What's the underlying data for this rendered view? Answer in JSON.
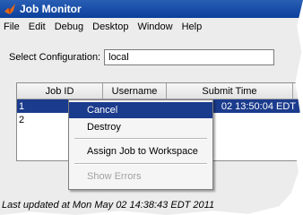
{
  "window": {
    "title": "Job Monitor"
  },
  "menu": [
    "File",
    "Edit",
    "Debug",
    "Desktop",
    "Window",
    "Help"
  ],
  "config": {
    "label": "Select Configuration:",
    "value": "local"
  },
  "table": {
    "headers": [
      "Job ID",
      "Username",
      "Submit Time"
    ],
    "rows": [
      {
        "id": "1",
        "username": "",
        "submit_time": "02 13:50:04 EDT"
      },
      {
        "id": "2",
        "username": "",
        "submit_time": ""
      }
    ]
  },
  "context_menu": {
    "items": [
      "Cancel",
      "Destroy",
      "Assign Job to Workspace",
      "Show Errors"
    ],
    "highlighted": "Cancel",
    "disabled": [
      "Show Errors"
    ]
  },
  "status_text": "Last updated at Mon May 02 14:38:43 EDT 2011",
  "colors": {
    "titlebar": "#0b3f9b",
    "selection": "#1b3b8c",
    "background": "#ececec"
  }
}
